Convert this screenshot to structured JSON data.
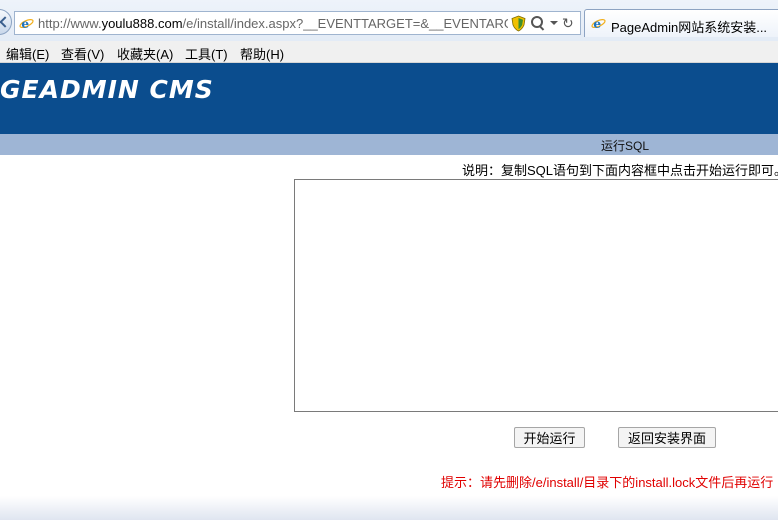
{
  "browser": {
    "address": {
      "prefix": "http://www.",
      "host": "youlu888.com",
      "path": "/e/install/index.aspx?__EVENTTARGET=&__EVENTARGUI"
    },
    "tab_title": "PageAdmin网站系统安装...",
    "menu": [
      "编辑(E)",
      "查看(V)",
      "收藏夹(A)",
      "工具(T)",
      "帮助(H)"
    ]
  },
  "header": {
    "logo_text": "GEADMIN CMS"
  },
  "page": {
    "title": "运行SQL",
    "description": "说明：复制SQL语句到下面内容框中点击开始运行即可。",
    "sql_value": "",
    "run_button": "开始运行",
    "back_button": "返回安装界面",
    "tip": "提示：请先删除/e/install/目录下的install.lock文件后再运行"
  },
  "colors": {
    "header": "#0b4d8e",
    "titlebar": "#9eb5d5",
    "tip": "#e00000"
  }
}
